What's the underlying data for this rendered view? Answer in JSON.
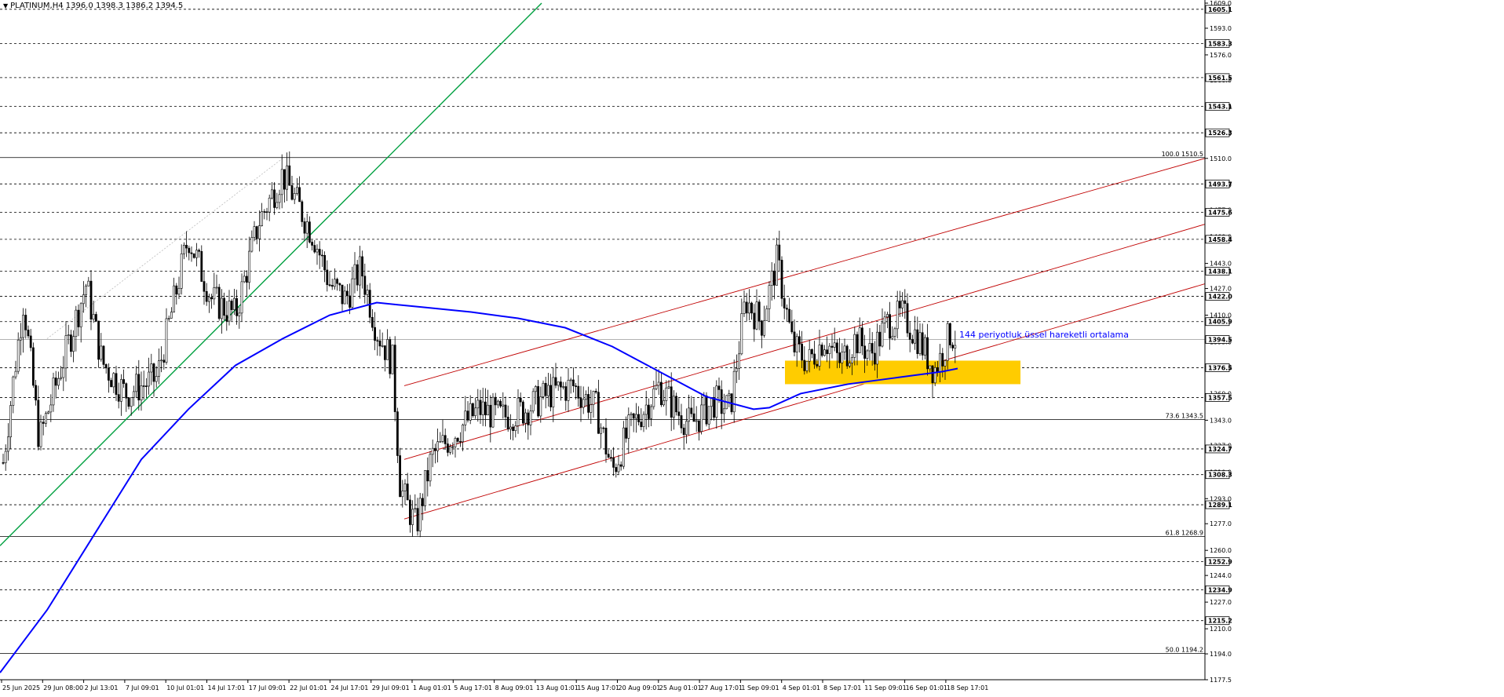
{
  "header": {
    "symbol": "PLATINUM,H4",
    "ohlc": "1396.0 1398.3 1386.2 1394.5"
  },
  "colors": {
    "background": "#ffffff",
    "grid": "#000000",
    "candle": "#000000",
    "ema": "#0000ff",
    "uptrend": "#00a040",
    "channel": "#c00000",
    "zone": "#ffcc00",
    "annotation": "#0000ff"
  },
  "annotation_text": "144 periyotluk üssel hareketli ortalama",
  "chart_data": {
    "type": "candlestick",
    "title": "PLATINUM,H4",
    "ylim": [
      1177.5,
      1609.0
    ],
    "price_ticks": [
      1609.0,
      1593.0,
      1576.0,
      1560.0,
      1543.0,
      1526.0,
      1510.0,
      1493.0,
      1477.0,
      1460.0,
      1443.0,
      1427.0,
      1410.0,
      1393.0,
      1377.0,
      1360.0,
      1343.0,
      1327.0,
      1310.0,
      1293.0,
      1277.0,
      1260.0,
      1244.0,
      1227.0,
      1210.0,
      1194.0,
      1177.5
    ],
    "level_labels": [
      "1605.1",
      "1583.3",
      "1561.5",
      "1543.1",
      "1526.3",
      "1493.7",
      "1475.6",
      "1458.4",
      "1438.1",
      "1422.0",
      "1405.9",
      "1394.5",
      "1376.5",
      "1357.5",
      "1324.7",
      "1308.3",
      "1289.1",
      "1252.9",
      "1234.9",
      "1215.2"
    ],
    "levels": [
      1605.1,
      1583.3,
      1561.5,
      1543.1,
      1526.3,
      1493.7,
      1475.6,
      1458.4,
      1438.1,
      1422.0,
      1405.9,
      1376.5,
      1357.5,
      1324.7,
      1308.3,
      1289.1,
      1252.9,
      1234.9,
      1215.2
    ],
    "current_price": 1394.5,
    "fibonacci": [
      {
        "label": "100.0 1510.5",
        "price": 1510.5
      },
      {
        "label": "73.6 1343.5",
        "price": 1343.5
      },
      {
        "label": "61.8 1268.9",
        "price": 1268.9
      },
      {
        "label": "50.0 1194.2",
        "price": 1194.2
      }
    ],
    "x_labels": [
      "25 Jun 2025",
      "29 Jun 08:00",
      "2 Jul 13:01",
      "7 Jul 09:01",
      "10 Jul 01:01",
      "14 Jul 17:01",
      "17 Jul 09:01",
      "22 Jul 01:01",
      "24 Jul 17:01",
      "29 Jul 09:01",
      "1 Aug 01:01",
      "5 Aug 17:01",
      "8 Aug 09:01",
      "13 Aug 01:01",
      "15 Aug 17:01",
      "20 Aug 09:01",
      "25 Aug 01:01",
      "27 Aug 17:01",
      "1 Sep 09:01",
      "4 Sep 01:01",
      "8 Sep 17:01",
      "11 Sep 09:01",
      "16 Sep 01:01",
      "18 Sep 17:01"
    ],
    "series": [
      {
        "kind": "ema",
        "period": 144,
        "points": [
          [
            0,
            1182
          ],
          [
            60,
            1222
          ],
          [
            120,
            1270
          ],
          [
            180,
            1318
          ],
          [
            240,
            1350
          ],
          [
            300,
            1378
          ],
          [
            360,
            1395
          ],
          [
            420,
            1410
          ],
          [
            480,
            1418
          ],
          [
            540,
            1415
          ],
          [
            600,
            1412
          ],
          [
            660,
            1408
          ],
          [
            720,
            1402
          ],
          [
            780,
            1390
          ],
          [
            840,
            1374
          ],
          [
            900,
            1358
          ],
          [
            960,
            1350
          ],
          [
            980,
            1351
          ],
          [
            1020,
            1360
          ],
          [
            1080,
            1366
          ],
          [
            1140,
            1370
          ],
          [
            1200,
            1374
          ],
          [
            1220,
            1376
          ]
        ]
      },
      {
        "kind": "close",
        "points": [
          [
            0,
            1300
          ],
          [
            20,
            1380
          ],
          [
            30,
            1420
          ],
          [
            50,
            1330
          ],
          [
            80,
            1380
          ],
          [
            110,
            1430
          ],
          [
            130,
            1380
          ],
          [
            160,
            1360
          ],
          [
            200,
            1370
          ],
          [
            240,
            1460
          ],
          [
            270,
            1420
          ],
          [
            300,
            1410
          ],
          [
            330,
            1470
          ],
          [
            360,
            1500
          ],
          [
            400,
            1460
          ],
          [
            420,
            1430
          ],
          [
            440,
            1420
          ],
          [
            460,
            1440
          ],
          [
            480,
            1400
          ],
          [
            500,
            1380
          ],
          [
            510,
            1300
          ],
          [
            530,
            1275
          ],
          [
            550,
            1320
          ],
          [
            580,
            1335
          ],
          [
            610,
            1350
          ],
          [
            640,
            1345
          ],
          [
            670,
            1350
          ],
          [
            700,
            1360
          ],
          [
            730,
            1365
          ],
          [
            760,
            1350
          ],
          [
            780,
            1310
          ],
          [
            800,
            1335
          ],
          [
            820,
            1350
          ],
          [
            840,
            1365
          ],
          [
            860,
            1350
          ],
          [
            880,
            1340
          ],
          [
            910,
            1355
          ],
          [
            930,
            1350
          ],
          [
            950,
            1420
          ],
          [
            970,
            1405
          ],
          [
            990,
            1445
          ],
          [
            1010,
            1390
          ],
          [
            1030,
            1380
          ],
          [
            1050,
            1395
          ],
          [
            1070,
            1380
          ],
          [
            1090,
            1395
          ],
          [
            1110,
            1385
          ],
          [
            1130,
            1405
          ],
          [
            1150,
            1410
          ],
          [
            1170,
            1395
          ],
          [
            1190,
            1375
          ],
          [
            1200,
            1385
          ],
          [
            1210,
            1398
          ],
          [
            1220,
            1394.5
          ]
        ]
      }
    ],
    "trendlines": [
      {
        "kind": "uptrend",
        "color": "green",
        "from": [
          0,
          1263
        ],
        "to": [
          690,
          1609
        ]
      },
      {
        "kind": "channel",
        "color": "red",
        "from": [
          515,
          1365
        ],
        "to": [
          1535,
          1510
        ]
      },
      {
        "kind": "channel",
        "color": "red",
        "from": [
          515,
          1318
        ],
        "to": [
          1535,
          1468
        ]
      },
      {
        "kind": "channel",
        "color": "red",
        "from": [
          515,
          1280
        ],
        "to": [
          1535,
          1430
        ]
      }
    ],
    "zone": {
      "x_from": 1000,
      "x_to": 1300,
      "price_low": 1366,
      "price_high": 1381
    },
    "grid": false
  }
}
